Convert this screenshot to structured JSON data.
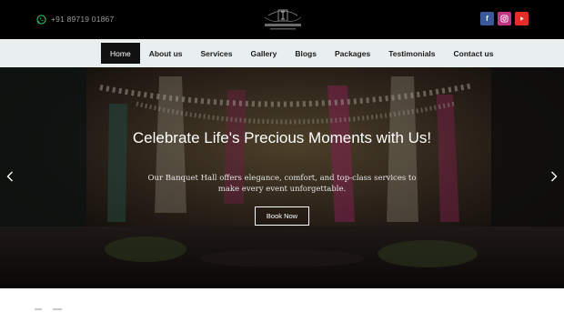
{
  "header": {
    "phone": "+91 89719 01867",
    "phone_icon": "whatsapp-icon",
    "logo_icon": "banquet-crest-logo",
    "socials": [
      {
        "name": "facebook",
        "glyph": "f",
        "color": "#3b5998"
      },
      {
        "name": "instagram",
        "glyph": "◎",
        "color": "#c13584"
      },
      {
        "name": "youtube",
        "glyph": "▶",
        "color": "#e52d27"
      }
    ]
  },
  "nav": {
    "items": [
      {
        "label": "Home",
        "active": true
      },
      {
        "label": "About us"
      },
      {
        "label": "Services"
      },
      {
        "label": "Gallery"
      },
      {
        "label": "Blogs"
      },
      {
        "label": "Packages"
      },
      {
        "label": "Testimonials"
      },
      {
        "label": "Contact us"
      }
    ]
  },
  "hero": {
    "title": "Celebrate Life's Precious Moments with Us!",
    "subtitle": "Our Banquet Hall offers elegance, comfort, and top-class services to make every event unforgettable.",
    "cta": "Book Now",
    "prev_icon": "chevron-left-icon",
    "next_icon": "chevron-right-icon"
  },
  "colors": {
    "topbar": "#000000",
    "navbar": "#e9eeee",
    "active_nav": "#111111"
  }
}
